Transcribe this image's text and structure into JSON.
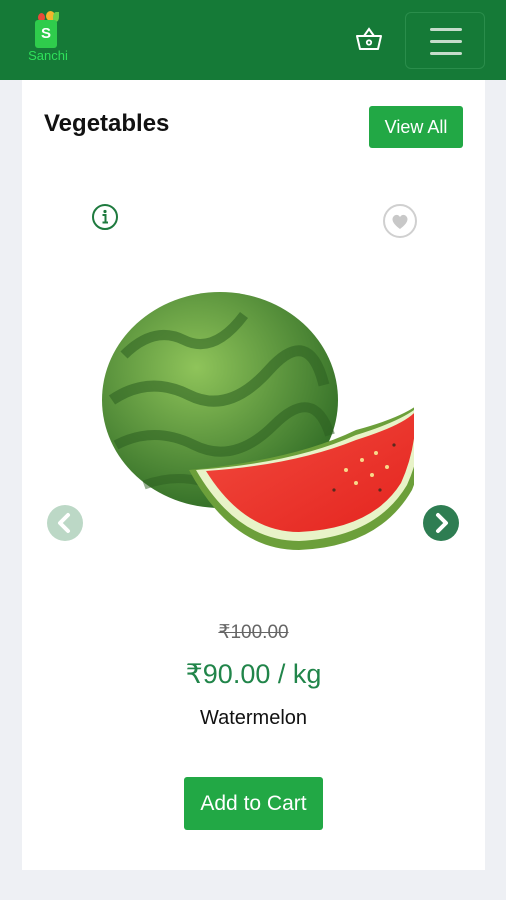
{
  "navbar": {
    "logo_text": "Sanchi",
    "logo_letter": "S",
    "cart_icon": "basket-icon",
    "menu_icon": "hamburger-icon"
  },
  "section": {
    "title": "Vegetables",
    "view_all_label": "View All"
  },
  "product": {
    "image": "watermelon",
    "old_price": "₹100.00",
    "price": "₹90.00 / kg",
    "name": "Watermelon",
    "add_to_cart_label": "Add to Cart",
    "info_icon": "info-icon",
    "wishlist_icon": "heart-icon"
  },
  "carousel": {
    "prev_icon": "chevron-left-icon",
    "next_icon": "chevron-right-icon"
  },
  "colors": {
    "navbar": "#157a37",
    "button": "#22a845",
    "price": "#21854a",
    "background": "#eef0f4"
  }
}
